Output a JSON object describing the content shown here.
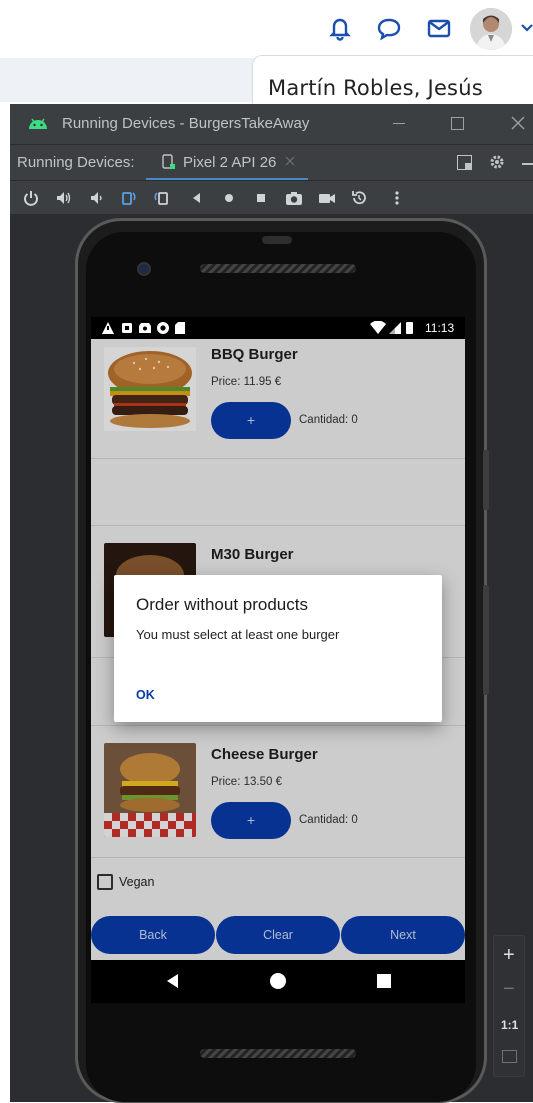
{
  "browser": {
    "icons": [
      "bell-icon",
      "chat-icon",
      "mail-icon",
      "avatar",
      "chevron-down-icon"
    ],
    "profile_name": "Martín Robles, Jesús"
  },
  "ide": {
    "window_title": "Running Devices - BurgersTakeAway",
    "panel_label": "Running Devices:",
    "device_tab": "Pixel 2 API 26",
    "toolbar_icons": [
      "power-icon",
      "volume-up-icon",
      "volume-down-icon",
      "rotate-left-icon",
      "rotate-right-icon",
      "back-icon",
      "home-icon",
      "overview-icon",
      "camera-icon",
      "video-icon",
      "restore-icon",
      "more-icon"
    ],
    "side_controls": {
      "zoom_in": "+",
      "zoom_out": "−",
      "actual_size": "1:1"
    }
  },
  "status_bar": {
    "time": "11:13"
  },
  "app": {
    "items": [
      {
        "name": "BBQ Burger",
        "price": "Price: 11.95 €",
        "add_label": "+",
        "qty": "Cantidad: 0"
      },
      {
        "name": "M30 Burger"
      },
      {
        "name": "Cheese Burger",
        "price": "Price: 13.50 €",
        "add_label": "+",
        "qty": "Cantidad: 0"
      }
    ],
    "vegan_label": "Vegan",
    "vegan_checked": false,
    "buttons": {
      "back": "Back",
      "clear": "Clear",
      "next": "Next"
    }
  },
  "dialog": {
    "title": "Order without products",
    "message": "You must select at least one burger",
    "ok": "OK"
  },
  "colors": {
    "primary": "#0a3aa6",
    "ide_bg": "#2b2d30",
    "ide_bar": "#3c3f41",
    "accent_tab": "#4a88c7"
  }
}
